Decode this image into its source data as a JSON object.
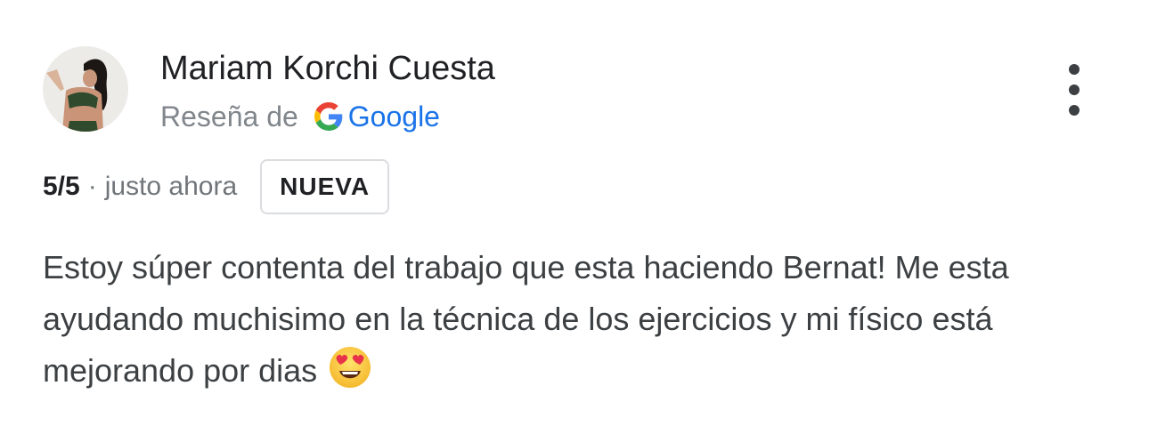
{
  "review": {
    "author_name": "Mariam Korchi Cuesta",
    "source_prefix": "Reseña de",
    "source_name": "Google",
    "rating": "5/5",
    "separator": "·",
    "time": "justo ahora",
    "badge": "NUEVA",
    "text": "Estoy súper contenta del trabajo que esta haciendo Bernat! Me esta ayudando muchisimo en la técnica de los ejercicios y mi físico está mejorando por dias",
    "emoji": "heart-eyes-emoji"
  },
  "icons": {
    "source_logo": "google-g-icon",
    "menu": "more-vertical-icon"
  },
  "colors": {
    "google_blue": "#1a73e8",
    "muted_text": "#70757a",
    "badge_border": "#dadce0"
  }
}
